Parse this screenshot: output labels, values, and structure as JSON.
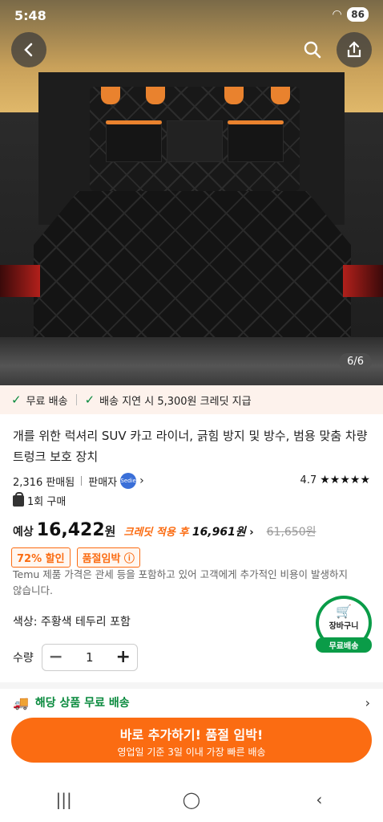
{
  "status_bar": {
    "time": "5:48",
    "battery": "86"
  },
  "gallery": {
    "counter": "6/6"
  },
  "shipping_strip": {
    "free_shipping": "무료 배송",
    "delay_credit": "배송 지연 시 5,300원 크레딧 지급"
  },
  "product": {
    "title": "개를 위한 럭셔리 SUV 카고 라이너, 긁힘 방지 및 방수, 범용 맞춤 차량 트렁크 보호 장치",
    "sold": "2,316 판매됨",
    "seller": "판매자",
    "seller_badge": "Sedie",
    "rating": "4.7",
    "stars": "★★★★★",
    "bought_count": "1회 구매"
  },
  "price": {
    "prefix": "예상",
    "amount": "16,422",
    "unit": "원",
    "credit_label": "크레딧 적용 후",
    "credit_amount": "16,961원",
    "original": "61,650원"
  },
  "tags": {
    "discount": "72% 할인",
    "soldout": "품절임박 ⓘ"
  },
  "note": "Temu 제품 가격은 관세 등을 포함하고 있어 고객에게 추가적인 비용이 발생하지 않습니다.",
  "options": {
    "color_label": "색상: 주황색 테두리 포함",
    "qty_label": "수량",
    "qty_value": "1",
    "minus": "−",
    "plus": "+"
  },
  "cart_button": {
    "label": "장바구니",
    "free": "무료배송"
  },
  "free_ship_row": {
    "label": "해당 상품 무료 배송"
  },
  "cta": {
    "main": "바로 추가하기! 품절 임박!",
    "sub": "영업일 기준 3일 이내 가장 빠른 배송"
  },
  "colors": {
    "accent": "#fb6c12",
    "green": "#0a8a3e"
  }
}
